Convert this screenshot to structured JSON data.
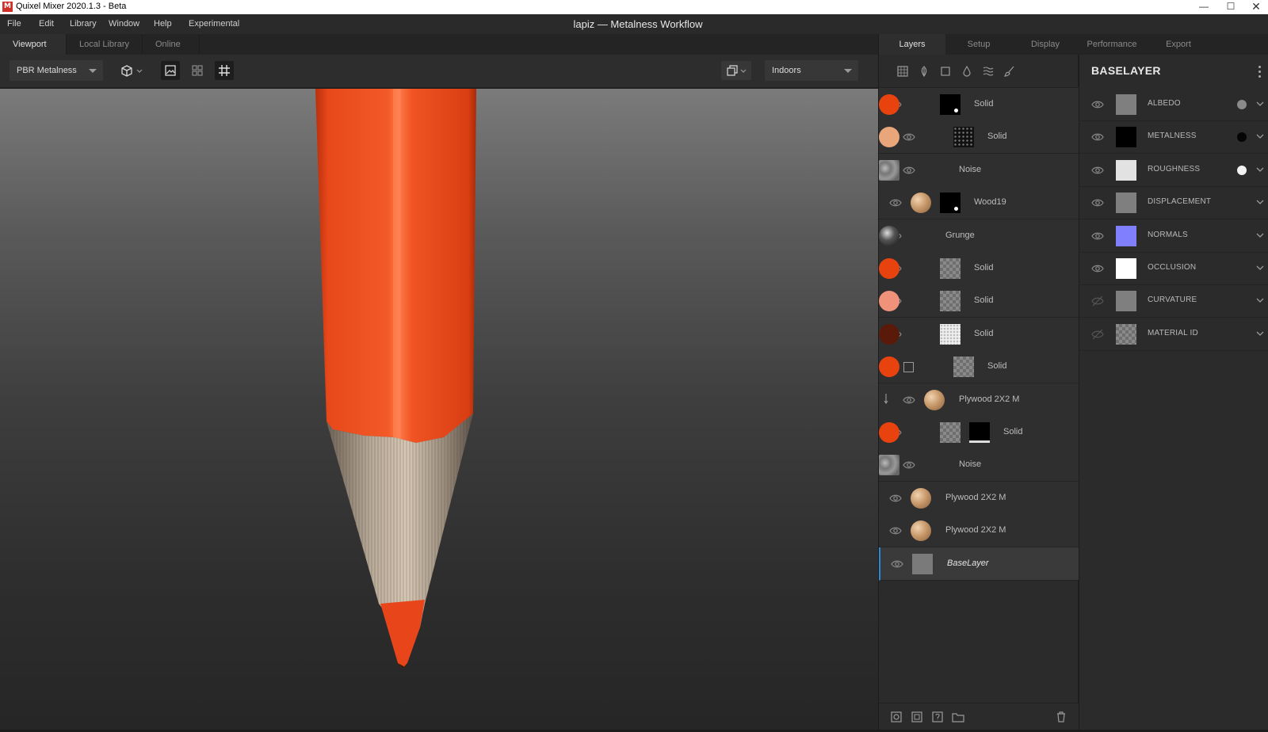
{
  "titlebar": {
    "app_title": "Quixel Mixer 2020.1.3 - Beta",
    "logo": "M"
  },
  "menu": [
    "File",
    "Edit",
    "Library",
    "Window",
    "Help",
    "Experimental"
  ],
  "document_title": "lapiz — Metalness Workflow",
  "viewport_tabs": [
    "Viewport",
    "Local Library",
    "Online"
  ],
  "viewport_toolbar": {
    "render_mode": "PBR Metalness",
    "environment": "Indoors"
  },
  "panel_tabs": [
    "Layers",
    "Setup",
    "Display",
    "Performance",
    "Export"
  ],
  "layers": [
    {
      "name": "Solid",
      "color": "#e8420f",
      "mask": "black-dot",
      "clipped": false,
      "visible": true
    },
    {
      "name": "Solid",
      "color": "#e8a67a",
      "mask": "speckle",
      "clipped": true,
      "visible": true
    },
    {
      "name": "Noise",
      "color": "noise",
      "mask": "",
      "clipped": true,
      "visible": true
    },
    {
      "name": "Wood19",
      "color": "wood",
      "mask": "black-dot",
      "clipped": false,
      "visible": true
    },
    {
      "name": "Grunge",
      "color": "grunge",
      "mask": "",
      "clipped": false,
      "visible": true
    },
    {
      "name": "Solid",
      "color": "#e8420f",
      "mask": "checker",
      "clipped": false,
      "visible": true
    },
    {
      "name": "Solid",
      "color": "#f0917a",
      "mask": "checker",
      "clipped": false,
      "visible": true
    },
    {
      "name": "Solid",
      "color": "#5a1a0a",
      "mask": "light",
      "clipped": false,
      "visible": true
    },
    {
      "name": "Solid",
      "color": "#e8420f",
      "mask": "checker",
      "clipped": true,
      "visible": false
    },
    {
      "name": "Plywood 2X2 M",
      "color": "wood",
      "mask": "",
      "clipped": true,
      "visible": true
    },
    {
      "name": "Solid",
      "color": "#e8420f",
      "mask": "checker+black",
      "clipped": false,
      "visible": true
    },
    {
      "name": "Noise",
      "color": "noise",
      "mask": "",
      "clipped": true,
      "visible": true
    },
    {
      "name": "Plywood 2X2 M",
      "color": "wood",
      "mask": "",
      "clipped": false,
      "visible": true
    },
    {
      "name": "Plywood 2X2 M",
      "color": "wood",
      "mask": "",
      "clipped": false,
      "visible": true
    },
    {
      "name": "BaseLayer",
      "color": "#7a7a7a",
      "mask": "",
      "clipped": false,
      "visible": true,
      "selected": true
    }
  ],
  "properties": {
    "title": "BASELAYER",
    "channels": [
      {
        "name": "ALBEDO",
        "swatch": "#7f7f7f",
        "dot": "#8a8a8a",
        "visible": true
      },
      {
        "name": "METALNESS",
        "swatch": "#000000",
        "dot": "#050505",
        "visible": true
      },
      {
        "name": "ROUGHNESS",
        "swatch": "#e2e2e2",
        "dot": "#f2f2f2",
        "visible": true
      },
      {
        "name": "DISPLACEMENT",
        "swatch": "#7f7f7f",
        "dot": "",
        "visible": true
      },
      {
        "name": "NORMALS",
        "swatch": "#8080ff",
        "dot": "",
        "visible": true
      },
      {
        "name": "OCCLUSION",
        "swatch": "#ffffff",
        "dot": "",
        "visible": true
      },
      {
        "name": "CURVATURE",
        "swatch": "#7f7f7f",
        "dot": "",
        "visible": false
      },
      {
        "name": "MATERIAL ID",
        "swatch": "checker",
        "dot": "",
        "visible": false
      }
    ]
  }
}
